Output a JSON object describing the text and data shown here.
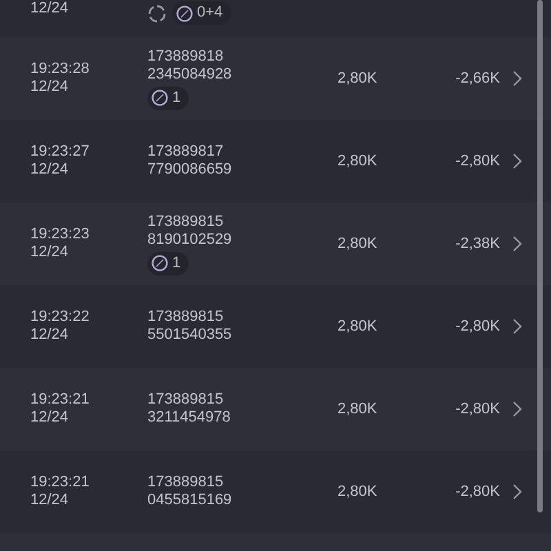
{
  "top_row": {
    "date": "12/24",
    "badges": [
      {
        "kind": "sync"
      },
      {
        "kind": "link",
        "label": "0+4"
      }
    ]
  },
  "rows": [
    {
      "time": "19:23:28",
      "date": "12/24",
      "id_line_1": "173889818",
      "id_line_2": "2345084928",
      "badges": [
        {
          "kind": "link",
          "label": "1"
        }
      ],
      "amount": "2,80K",
      "pnl": "-2,66K"
    },
    {
      "time": "19:23:27",
      "date": "12/24",
      "id_line_1": "173889817",
      "id_line_2": "7790086659",
      "amount": "2,80K",
      "pnl": "-2,80K"
    },
    {
      "time": "19:23:23",
      "date": "12/24",
      "id_line_1": "173889815",
      "id_line_2": "8190102529",
      "badges": [
        {
          "kind": "link",
          "label": "1"
        }
      ],
      "amount": "2,80K",
      "pnl": "-2,38K"
    },
    {
      "time": "19:23:22",
      "date": "12/24",
      "id_line_1": "173889815",
      "id_line_2": "5501540355",
      "amount": "2,80K",
      "pnl": "-2,80K"
    },
    {
      "time": "19:23:21",
      "date": "12/24",
      "id_line_1": "173889815",
      "id_line_2": "3211454978",
      "amount": "2,80K",
      "pnl": "-2,80K"
    },
    {
      "time": "19:23:21",
      "date": "12/24",
      "id_line_1": "173889815",
      "id_line_2": "0455815169",
      "amount": "2,80K",
      "pnl": "-2,80K"
    }
  ]
}
